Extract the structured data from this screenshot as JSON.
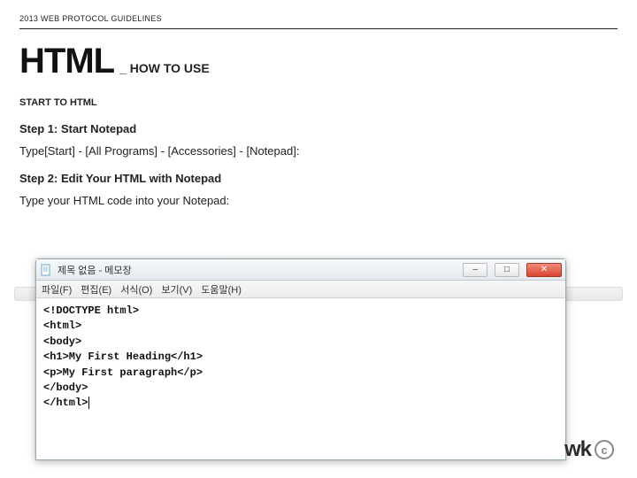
{
  "header": {
    "topline": "2013 WEB PROTOCOL GUIDELINES",
    "title_main": "HTML",
    "title_sub": "_ HOW TO USE"
  },
  "section": {
    "label": "START TO HTML",
    "step1_title": "Step 1: Start Notepad",
    "step1_body": "Type[Start] - [All Programs] - [Accessories] - [Notepad]:",
    "step2_title": "Step 2: Edit Your HTML with Notepad",
    "step2_body": "Type your HTML code into your Notepad:"
  },
  "notepad": {
    "window_title": "제목 없음 - 메모장",
    "menu": [
      "파일(F)",
      "편집(E)",
      "서식(O)",
      "보기(V)",
      "도움말(H)"
    ],
    "code_lines": [
      "<!DOCTYPE html>",
      "<html>",
      "<body>",
      "",
      "<h1>My First Heading</h1>",
      "",
      "<p>My First paragraph</p>",
      "",
      "</body>",
      "</html>"
    ],
    "btn_min": "–",
    "btn_max": "□",
    "btn_close": "✕"
  },
  "logo": {
    "text": "wk",
    "mark": "c"
  }
}
